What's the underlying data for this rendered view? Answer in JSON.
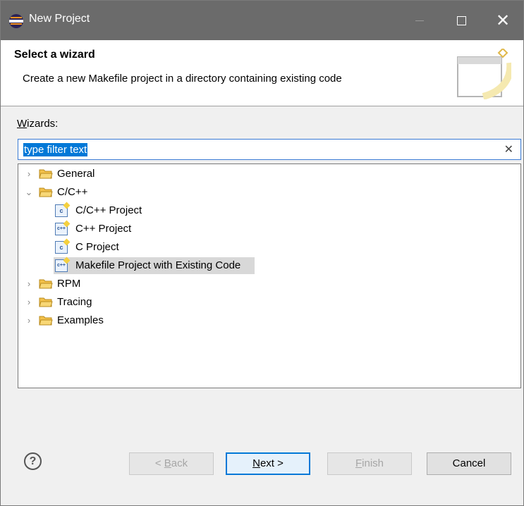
{
  "window": {
    "title": "New Project"
  },
  "header": {
    "title": "Select a wizard",
    "description": "Create a new Makefile project in a directory containing existing code"
  },
  "wizards": {
    "label_prefix": "W",
    "label_rest": "izards:",
    "filter_text": "type filter text"
  },
  "tree": {
    "items": [
      {
        "label": "General",
        "expanded": false
      },
      {
        "label": "C/C++",
        "expanded": true
      },
      {
        "label": "C/C++ Project",
        "icon": "c"
      },
      {
        "label": "C++ Project",
        "icon": "c++"
      },
      {
        "label": "C Project",
        "icon": "c"
      },
      {
        "label": "Makefile Project with Existing Code",
        "icon": "c++",
        "selected": true
      },
      {
        "label": "RPM",
        "expanded": false
      },
      {
        "label": "Tracing",
        "expanded": false
      },
      {
        "label": "Examples",
        "expanded": false
      }
    ]
  },
  "buttons": {
    "back_prefix": "< ",
    "back_mnemonic": "B",
    "back_rest": "ack",
    "next_mnemonic": "N",
    "next_rest": "ext >",
    "finish_mnemonic": "F",
    "finish_rest": "inish",
    "cancel": "Cancel"
  },
  "icons": {
    "help": "?",
    "clear": "✕"
  },
  "colors": {
    "titlebar": "#6b6b6b",
    "selection": "#0078d7",
    "tree_selected": "#d8d8d8",
    "folder": "#f3c14b"
  }
}
